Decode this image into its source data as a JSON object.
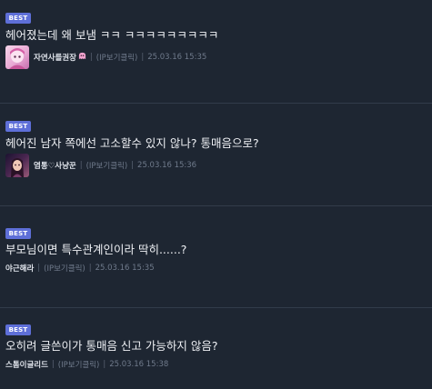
{
  "best_label": "BEST",
  "comments": [
    {
      "text": "헤어졌는데 왜 보냄 ㅋㅋ  ㅋㅋㅋㅋㅋㅋㅋㅋㅋ",
      "nickname": "자연사를권장",
      "nickname_icon": "ghost-icon",
      "ip_note": "(IP보기클릭)",
      "date": "25.03.16 15:35",
      "has_avatar": true
    },
    {
      "text": "헤어진 남자 쪽에선 고소할수 있지 않나? 통매음으로?",
      "nickname": "염통♡사냥꾼",
      "ip_note": "(IP보기클릭)",
      "date": "25.03.16 15:36",
      "has_avatar": true
    },
    {
      "text": "부모님이면 특수관계인이라 딱히......?",
      "nickname": "야근해라",
      "ip_note": "(IP보기클릭)",
      "date": "25.03.16 15:35",
      "has_avatar": false
    },
    {
      "text": "오히려 글쓴이가 통매음 신고 가능하지 않음?",
      "nickname": "스톰이글리드",
      "ip_note": "(IP보기클릭)",
      "date": "25.03.16 15:38",
      "has_avatar": false
    }
  ],
  "separator": "|",
  "colors": {
    "background": "#1e2632",
    "best_badge": "#5e6fd8",
    "divider": "#323c4a",
    "meta_text": "#6f7a8b"
  }
}
